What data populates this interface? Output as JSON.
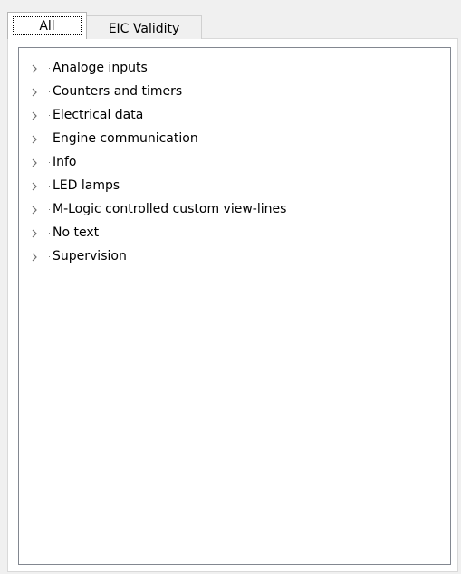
{
  "tabs": [
    {
      "label": "All",
      "selected": true
    },
    {
      "label": "EIC Validity",
      "selected": false
    }
  ],
  "tree": {
    "items": [
      {
        "label": "Analoge inputs",
        "icon": "chevron-right-icon"
      },
      {
        "label": "Counters and timers",
        "icon": "chevron-right-icon"
      },
      {
        "label": "Electrical data",
        "icon": "chevron-right-icon"
      },
      {
        "label": "Engine communication",
        "icon": "chevron-right-icon"
      },
      {
        "label": "Info",
        "icon": "chevron-right-icon"
      },
      {
        "label": "LED lamps",
        "icon": "chevron-right-icon"
      },
      {
        "label": "M-Logic controlled custom view-lines",
        "icon": "chevron-right-icon"
      },
      {
        "label": "No text",
        "icon": "chevron-right-icon"
      },
      {
        "label": "Supervision",
        "icon": "chevron-right-icon"
      }
    ]
  },
  "colors": {
    "background": "#f0f0f0",
    "panel": "#ffffff",
    "tree_border": "#828790",
    "chevron": "#6d6d6d"
  }
}
